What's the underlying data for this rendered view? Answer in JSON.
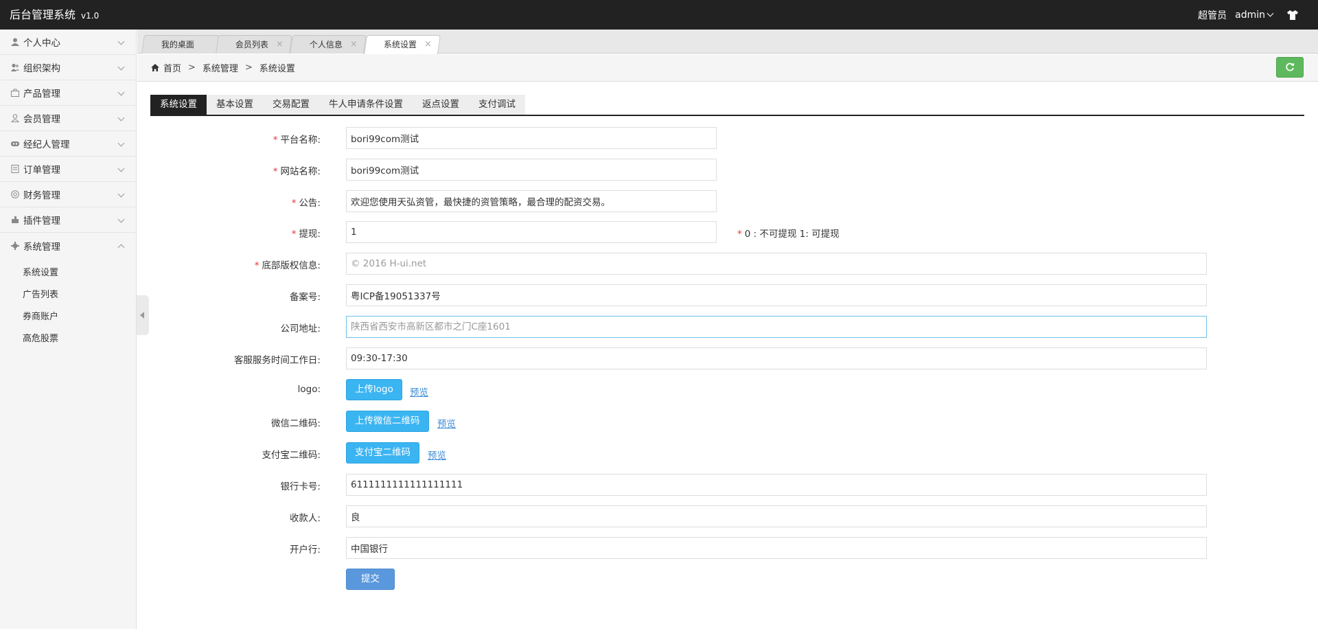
{
  "header": {
    "brand": "后台管理系统",
    "version": "v1.0",
    "role": "超管员",
    "user": "admin"
  },
  "sidebar": {
    "items": [
      {
        "label": "个人中心",
        "icon": "user-icon"
      },
      {
        "label": "组织架构",
        "icon": "org-icon"
      },
      {
        "label": "产品管理",
        "icon": "briefcase-icon"
      },
      {
        "label": "会员管理",
        "icon": "member-icon"
      },
      {
        "label": "经纪人管理",
        "icon": "broker-icon"
      },
      {
        "label": "订单管理",
        "icon": "order-icon"
      },
      {
        "label": "财务管理",
        "icon": "finance-icon"
      },
      {
        "label": "插件管理",
        "icon": "plugin-icon"
      },
      {
        "label": "系统管理",
        "icon": "gear-icon"
      }
    ],
    "submenu": [
      "系统设置",
      "广告列表",
      "券商账户",
      "高危股票"
    ]
  },
  "tabs": [
    {
      "label": "我的桌面"
    },
    {
      "label": "会员列表"
    },
    {
      "label": "个人信息"
    },
    {
      "label": "系统设置"
    }
  ],
  "tab_close": "×",
  "breadcrumb": {
    "home": "首页",
    "sep": ">",
    "level1": "系统管理",
    "level2": "系统设置"
  },
  "settings_tabs": [
    "系统设置",
    "基本设置",
    "交易配置",
    "牛人申请条件设置",
    "返点设置",
    "支付调试"
  ],
  "form": {
    "platform_name": {
      "label": "平台名称:",
      "value": "bori99com测试"
    },
    "site_name": {
      "label": "网站名称:",
      "value": "bori99com测试"
    },
    "notice": {
      "label": "公告:",
      "value": "欢迎您使用天弘资管，最快捷的资管策略，最合理的配资交易。"
    },
    "withdraw": {
      "label": "提现:",
      "value": "1",
      "hint": "0 : 不可提现 1:  可提现"
    },
    "copyright": {
      "label": "底部版权信息:",
      "placeholder": "© 2016 H-ui.net"
    },
    "icp": {
      "label": "备案号:",
      "value": "粤ICP备19051337号"
    },
    "address": {
      "label": "公司地址:",
      "placeholder": "陕西省西安市高新区都市之门C座1601"
    },
    "service_time": {
      "label": "客服服务时间工作日:",
      "value": "09:30-17:30"
    },
    "logo": {
      "label": "logo:",
      "button": "上传logo",
      "preview": "预览"
    },
    "wechat_qr": {
      "label": "微信二维码:",
      "button": "上传微信二维码",
      "preview": "预览"
    },
    "alipay_qr": {
      "label": "支付宝二维码:",
      "button": "支付宝二维码",
      "preview": "预览"
    },
    "bank_card": {
      "label": "银行卡号:",
      "value": "6111111111111111111"
    },
    "payee": {
      "label": "收款人:",
      "value": "良"
    },
    "bank": {
      "label": "开户行:",
      "value": "中国银行"
    },
    "submit": "提交",
    "required_mark": "*"
  },
  "colors": {
    "topbar": "#222222",
    "upload_button": "#3bb4f2",
    "submit_button": "#5a98de",
    "refresh_button": "#5eb95e",
    "required": "#ee3333"
  }
}
